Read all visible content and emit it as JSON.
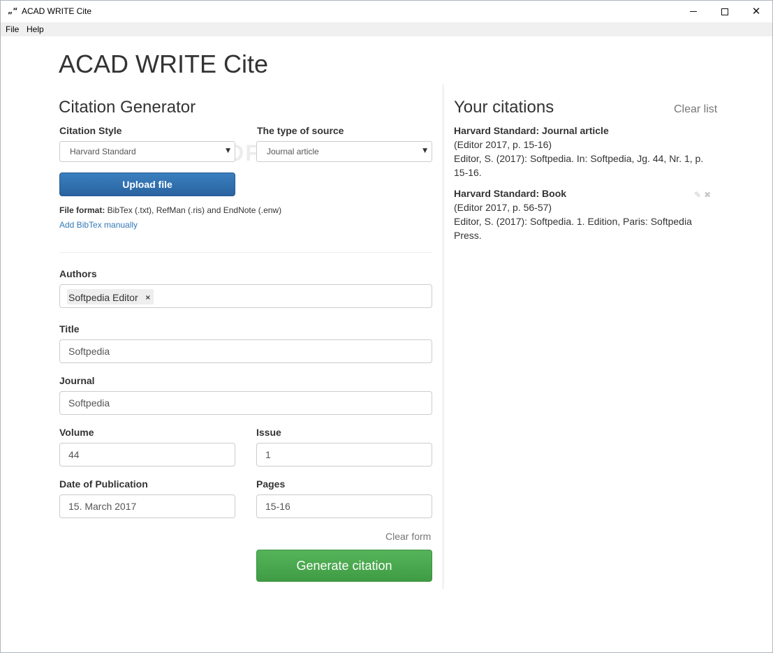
{
  "window": {
    "title": "ACAD WRITE Cite",
    "icon": "app-icon",
    "minimize": "minimize",
    "maximize": "maximize",
    "close": "close"
  },
  "menu": {
    "items": [
      "File",
      "Help"
    ]
  },
  "app_heading": "ACAD WRITE Cite",
  "generator": {
    "title": "Citation Generator",
    "citation_style_label": "Citation Style",
    "citation_style_value": "Harvard Standard",
    "source_type_label": "The type of source",
    "source_type_value": "Journal article",
    "upload_label": "Upload file",
    "file_format_label": "File format:",
    "file_format_text": " BibTex (.txt), RefMan (.ris) and EndNote (.enw)",
    "add_bibtex": "Add BibTex manually",
    "authors_label": "Authors",
    "authors": [
      "Softpedia Editor"
    ],
    "author_remove": "×",
    "title_label": "Title",
    "title_value": "Softpedia",
    "journal_label": "Journal",
    "journal_value": "Softpedia",
    "volume_label": "Volume",
    "volume_value": "44",
    "issue_label": "Issue",
    "issue_value": "1",
    "date_label": "Date of Publication",
    "date_value": "15. March 2017",
    "pages_label": "Pages",
    "pages_value": "15-16",
    "clear_form": "Clear form",
    "generate": "Generate citation"
  },
  "citations": {
    "title": "Your citations",
    "clear_list": "Clear list",
    "items": [
      {
        "heading": "Harvard Standard: Journal article",
        "intext": "(Editor 2017, p. 15-16)",
        "reference": "Editor, S. (2017): Softpedia. In: Softpedia, Jg. 44, Nr. 1, p. 15-16."
      },
      {
        "heading": "Harvard Standard: Book",
        "intext": "(Editor 2017, p. 56-57)",
        "reference": "Editor, S. (2017): Softpedia. 1. Edition, Paris: Softpedia Press."
      }
    ]
  },
  "watermark": "SOFTPEDIA"
}
